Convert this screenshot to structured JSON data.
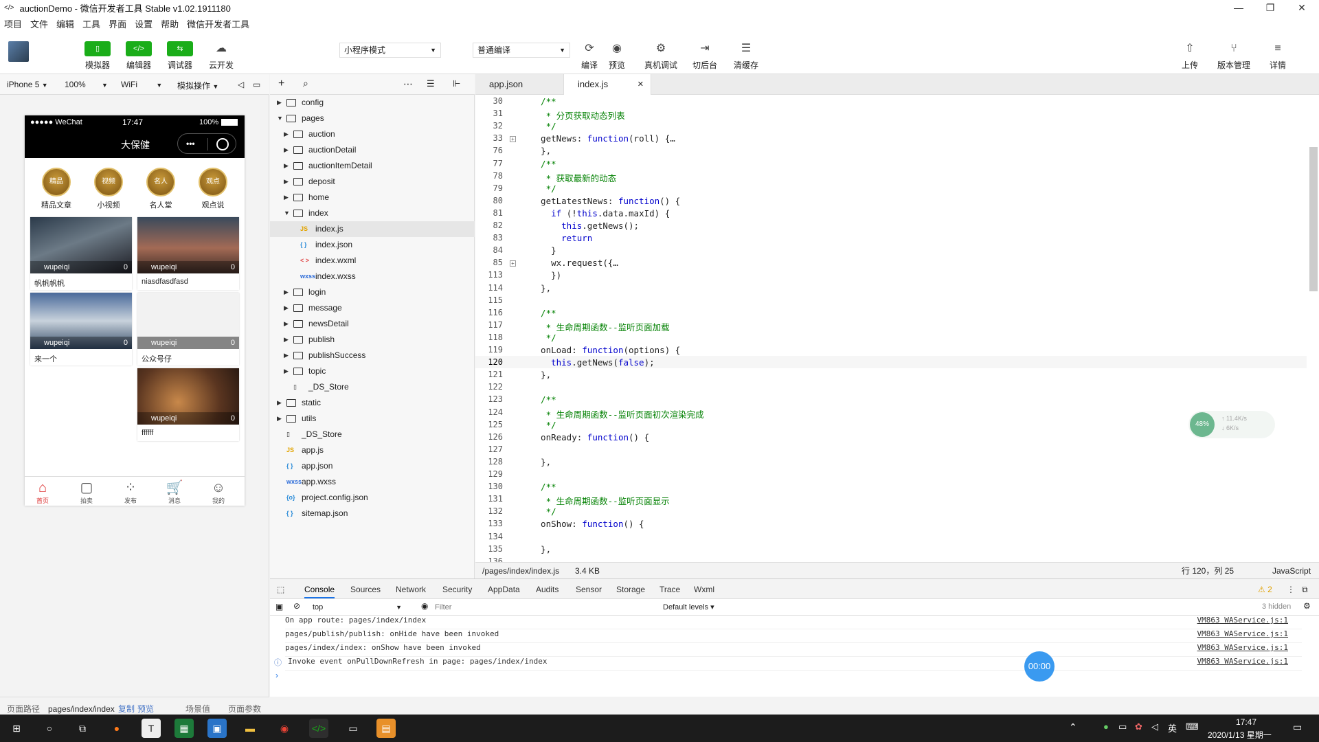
{
  "window": {
    "title": "auctionDemo - 微信开发者工具 Stable v1.02.1911180",
    "min": "—",
    "max": "❐",
    "close": "✕"
  },
  "menu": [
    "项目",
    "文件",
    "编辑",
    "工具",
    "界面",
    "设置",
    "帮助",
    "微信开发者工具"
  ],
  "toolbar": {
    "left": [
      {
        "icon": "▯",
        "label": "模拟器"
      },
      {
        "icon": "</>",
        "label": "编辑器"
      },
      {
        "icon": "⇆",
        "label": "调试器"
      },
      {
        "icon": "☁",
        "label": "云开发"
      }
    ],
    "mode": "小程序模式",
    "compile": "普通编译",
    "mid": [
      {
        "icon": "⟳",
        "label": "编译"
      },
      {
        "icon": "◉",
        "label": "预览"
      },
      {
        "icon": "⚙",
        "label": "真机调试"
      },
      {
        "icon": "⇥",
        "label": "切后台"
      },
      {
        "icon": "☰",
        "label": "清缓存"
      }
    ],
    "right": [
      {
        "icon": "⇧",
        "label": "上传"
      },
      {
        "icon": "⑂",
        "label": "版本管理"
      },
      {
        "icon": "≡",
        "label": "详情"
      }
    ]
  },
  "simbar": {
    "device": "iPhone 5",
    "zoom": "100%",
    "network": "WiFi",
    "ops": "模拟操作"
  },
  "phone": {
    "status": {
      "carrier": "●●●●● WeChat",
      "time": "17:47",
      "battery": "100%"
    },
    "nav_title": "大保健",
    "nav_more": "•••",
    "categories": [
      {
        "badge": "精品",
        "label": "精品文章"
      },
      {
        "badge": "视频",
        "label": "小视频"
      },
      {
        "badge": "名人",
        "label": "名人堂"
      },
      {
        "badge": "观点",
        "label": "观点说"
      }
    ],
    "cards": [
      {
        "user": "wupeiqi",
        "count": "0",
        "caption": "帆帆帆帆"
      },
      {
        "user": "wupeiqi",
        "count": "0",
        "caption": "niasdfasdfasd"
      },
      {
        "user": "wupeiqi",
        "count": "0",
        "caption": "来一个"
      },
      {
        "user": "wupeiqi",
        "count": "0",
        "caption": "公众号仔"
      },
      {
        "user": "wupeiqi",
        "count": "0",
        "caption": "ffffff"
      }
    ],
    "tabs": [
      {
        "icon": "⌂",
        "label": "首页"
      },
      {
        "icon": "▢",
        "label": "拍卖"
      },
      {
        "icon": "⁘",
        "label": "发布"
      },
      {
        "icon": "🛒",
        "label": "消息"
      },
      {
        "icon": "☺",
        "label": "我的"
      }
    ]
  },
  "files": [
    {
      "name": "config",
      "type": "folder",
      "arrow": "▶"
    },
    {
      "name": "pages",
      "type": "folder",
      "arrow": "▼"
    },
    {
      "name": "auction",
      "type": "folder",
      "arrow": "▶"
    },
    {
      "name": "auctionDetail",
      "type": "folder",
      "arrow": "▶"
    },
    {
      "name": "auctionItemDetail",
      "type": "folder",
      "arrow": "▶"
    },
    {
      "name": "deposit",
      "type": "folder",
      "arrow": "▶"
    },
    {
      "name": "home",
      "type": "folder",
      "arrow": "▶"
    },
    {
      "name": "index",
      "type": "folder",
      "arrow": "▼"
    },
    {
      "name": "index.js",
      "type": "js",
      "icon": "JS"
    },
    {
      "name": "index.json",
      "type": "json",
      "icon": "{ }"
    },
    {
      "name": "index.wxml",
      "type": "wxml",
      "icon": "< >"
    },
    {
      "name": "index.wxss",
      "type": "wxss",
      "icon": "wxss"
    },
    {
      "name": "login",
      "type": "folder",
      "arrow": "▶"
    },
    {
      "name": "message",
      "type": "folder",
      "arrow": "▶"
    },
    {
      "name": "newsDetail",
      "type": "folder",
      "arrow": "▶"
    },
    {
      "name": "publish",
      "type": "folder",
      "arrow": "▶"
    },
    {
      "name": "publishSuccess",
      "type": "folder",
      "arrow": "▶"
    },
    {
      "name": "topic",
      "type": "folder",
      "arrow": "▶"
    },
    {
      "name": "_DS_Store",
      "type": "file",
      "icon": "▯"
    },
    {
      "name": "static",
      "type": "folder",
      "arrow": "▶"
    },
    {
      "name": "utils",
      "type": "folder",
      "arrow": "▶"
    },
    {
      "name": "_DS_Store",
      "type": "file",
      "icon": "▯"
    },
    {
      "name": "app.js",
      "type": "js",
      "icon": "JS"
    },
    {
      "name": "app.json",
      "type": "json",
      "icon": "{ }"
    },
    {
      "name": "app.wxss",
      "type": "wxss",
      "icon": "wxss"
    },
    {
      "name": "project.config.json",
      "type": "json",
      "icon": "{o}"
    },
    {
      "name": "sitemap.json",
      "type": "json",
      "icon": "{ }"
    }
  ],
  "editor_tabs": [
    "app.json",
    "index.js"
  ],
  "code": [
    {
      "n": "30",
      "t": "  /**",
      "c": "cm"
    },
    {
      "n": "31",
      "t": "   * 分页获取动态列表",
      "c": "cm"
    },
    {
      "n": "32",
      "t": "   */",
      "c": "cm"
    },
    {
      "n": "33",
      "t": "  getNews: function(roll) {…",
      "c": "",
      "fold": true
    },
    {
      "n": "76",
      "t": "  },",
      "c": ""
    },
    {
      "n": "77",
      "t": "  /**",
      "c": "cm"
    },
    {
      "n": "78",
      "t": "   * 获取最新的动态",
      "c": "cm"
    },
    {
      "n": "79",
      "t": "   */",
      "c": "cm"
    },
    {
      "n": "80",
      "t": "  getLatestNews: function() {",
      "c": ""
    },
    {
      "n": "81",
      "t": "    if (!this.data.maxId) {",
      "c": ""
    },
    {
      "n": "82",
      "t": "      this.getNews();",
      "c": ""
    },
    {
      "n": "83",
      "t": "      return",
      "c": ""
    },
    {
      "n": "84",
      "t": "    }",
      "c": ""
    },
    {
      "n": "85",
      "t": "    wx.request({…",
      "c": "",
      "fold": true
    },
    {
      "n": "113",
      "t": "    })",
      "c": ""
    },
    {
      "n": "114",
      "t": "  },",
      "c": ""
    },
    {
      "n": "115",
      "t": "",
      "c": ""
    },
    {
      "n": "116",
      "t": "  /**",
      "c": "cm"
    },
    {
      "n": "117",
      "t": "   * 生命周期函数--监听页面加载",
      "c": "cm"
    },
    {
      "n": "118",
      "t": "   */",
      "c": "cm"
    },
    {
      "n": "119",
      "t": "  onLoad: function(options) {",
      "c": ""
    },
    {
      "n": "120",
      "t": "    this.getNews(false);",
      "c": ""
    },
    {
      "n": "121",
      "t": "  },",
      "c": ""
    },
    {
      "n": "122",
      "t": "",
      "c": ""
    },
    {
      "n": "123",
      "t": "  /**",
      "c": "cm"
    },
    {
      "n": "124",
      "t": "   * 生命周期函数--监听页面初次渲染完成",
      "c": "cm"
    },
    {
      "n": "125",
      "t": "   */",
      "c": "cm"
    },
    {
      "n": "126",
      "t": "  onReady: function() {",
      "c": ""
    },
    {
      "n": "127",
      "t": "",
      "c": ""
    },
    {
      "n": "128",
      "t": "  },",
      "c": ""
    },
    {
      "n": "129",
      "t": "",
      "c": ""
    },
    {
      "n": "130",
      "t": "  /**",
      "c": "cm"
    },
    {
      "n": "131",
      "t": "   * 生命周期函数--监听页面显示",
      "c": "cm"
    },
    {
      "n": "132",
      "t": "   */",
      "c": "cm"
    },
    {
      "n": "133",
      "t": "  onShow: function() {",
      "c": ""
    },
    {
      "n": "134",
      "t": "",
      "c": ""
    },
    {
      "n": "135",
      "t": "  },",
      "c": ""
    },
    {
      "n": "136",
      "t": "",
      "c": ""
    }
  ],
  "edstatus": {
    "path": "/pages/index/index.js",
    "size": "3.4 KB",
    "pos": "行 120，列 25",
    "lang": "JavaScript"
  },
  "devtabs": [
    "Console",
    "Sources",
    "Network",
    "Security",
    "AppData",
    "Audits",
    "Sensor",
    "Storage",
    "Trace",
    "Wxml"
  ],
  "devtools": {
    "warn": "⚠ 2",
    "context": "top",
    "filter_placeholder": "Filter",
    "levels": "Default levels ▾",
    "hidden": "3 hidden"
  },
  "console": [
    {
      "text": "On app route: pages/index/index",
      "src": "VM863 WAService.js:1"
    },
    {
      "text": "pages/publish/publish: onHide have been invoked",
      "src": "VM863 WAService.js:1"
    },
    {
      "text": "pages/index/index: onShow have been invoked",
      "src": "VM863 WAService.js:1"
    },
    {
      "text": "Invoke event onPullDownRefresh in page: pages/index/index",
      "src": "VM863 WAService.js:1"
    }
  ],
  "pathbar": {
    "label": "页面路径",
    "path": "pages/index/index",
    "copy": "复制",
    "preview": "预览",
    "scene": "场景值",
    "params": "页面参数"
  },
  "timer": "00:00",
  "netw": {
    "pct": "48%",
    "up": "↑ 11.4K/s",
    "down": "↓ 6K/s"
  },
  "taskbar": {
    "ime": "英",
    "time": "17:47",
    "date": "2020/1/13 星期一"
  }
}
